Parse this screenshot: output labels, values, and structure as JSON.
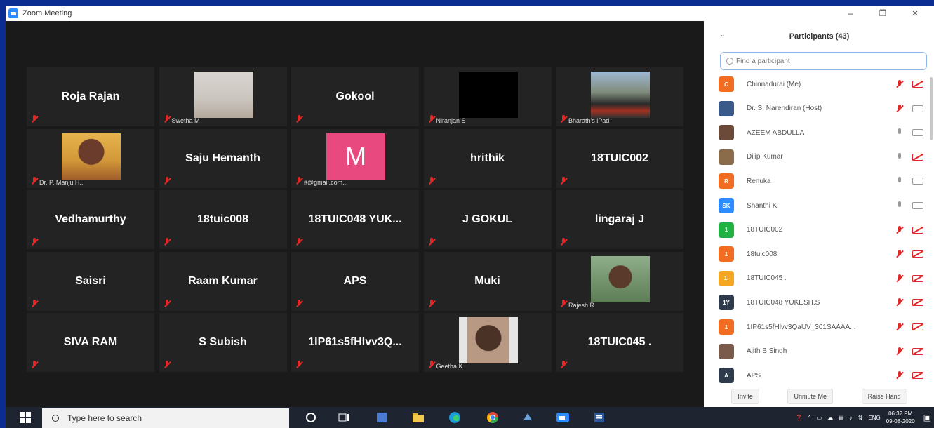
{
  "window": {
    "title": "Zoom Meeting",
    "controls": {
      "minimize": "–",
      "restore": "❐",
      "close": "✕"
    }
  },
  "gallery": {
    "tiles": [
      {
        "name": "Roja Rajan",
        "caption": ""
      },
      {
        "name": "",
        "caption": "Swetha M",
        "photo": "ph-roja-photo"
      },
      {
        "name": "Gokool",
        "caption": ""
      },
      {
        "name": "",
        "caption": "Niranjan S",
        "photo": "ph-black"
      },
      {
        "name": "",
        "caption": "Bharath's iPad",
        "photo": "ph-bike"
      },
      {
        "name": "",
        "caption": "Dr. P. Manju H...",
        "photo": "ph-woman"
      },
      {
        "name": "Saju Hemanth",
        "caption": ""
      },
      {
        "name": "",
        "caption": "#@gmail.com...",
        "photo": "ph-m",
        "letter": "M"
      },
      {
        "name": "hrithik",
        "caption": ""
      },
      {
        "name": "18TUIC002",
        "caption": ""
      },
      {
        "name": "Vedhamurthy",
        "caption": ""
      },
      {
        "name": "18tuic008",
        "caption": ""
      },
      {
        "name": "18TUIC048  YUK...",
        "caption": ""
      },
      {
        "name": "J GOKUL",
        "caption": ""
      },
      {
        "name": "lingaraj J",
        "caption": ""
      },
      {
        "name": "Saisri",
        "caption": ""
      },
      {
        "name": "Raam Kumar",
        "caption": ""
      },
      {
        "name": "APS",
        "caption": ""
      },
      {
        "name": "Muki",
        "caption": ""
      },
      {
        "name": "",
        "caption": "Rajesh R",
        "photo": "ph-rajesh"
      },
      {
        "name": "SIVA RAM",
        "caption": ""
      },
      {
        "name": "S Subish",
        "caption": ""
      },
      {
        "name": "1IP61s5fHlvv3Q...",
        "caption": ""
      },
      {
        "name": "",
        "caption": "Geetha K",
        "photo": "ph-geetha"
      },
      {
        "name": "18TUIC045 .",
        "caption": ""
      }
    ]
  },
  "participants_panel": {
    "title": "Participants (43)",
    "collapse_icon": "⌄",
    "search_placeholder": "Find a participant",
    "participants": [
      {
        "name": "Chinnadurai (Me)",
        "initials": "C",
        "color": "#f26d21",
        "mic": "muted",
        "video": "off"
      },
      {
        "name": "Dr. S. Narendiran (Host)",
        "initials": "",
        "color": "#3a5a8a",
        "mic": "muted",
        "video": "on"
      },
      {
        "name": "AZEEM ABDULLA",
        "initials": "",
        "color": "#6b4a3a",
        "mic": "on",
        "video": "on"
      },
      {
        "name": "Dilip Kumar",
        "initials": "",
        "color": "#8a6b4a",
        "mic": "on",
        "video": "off"
      },
      {
        "name": "Renuka",
        "initials": "R",
        "color": "#f26d21",
        "mic": "on",
        "video": "on"
      },
      {
        "name": "Shanthi K",
        "initials": "SK",
        "color": "#2d8cff",
        "mic": "on",
        "video": "on"
      },
      {
        "name": "18TUIC002",
        "initials": "1",
        "color": "#1fb141",
        "mic": "muted",
        "video": "off"
      },
      {
        "name": "18tuic008",
        "initials": "1",
        "color": "#f26d21",
        "mic": "muted",
        "video": "off"
      },
      {
        "name": "18TUIC045 .",
        "initials": "1.",
        "color": "#f5a623",
        "mic": "muted",
        "video": "off"
      },
      {
        "name": "18TUIC048 YUKESH.S",
        "initials": "1Y",
        "color": "#2f3b4c",
        "mic": "muted",
        "video": "off"
      },
      {
        "name": "1IP61s5fHlvv3QaUV_301SAAAA...",
        "initials": "1",
        "color": "#f26d21",
        "mic": "muted",
        "video": "off"
      },
      {
        "name": "Ajith B Singh",
        "initials": "",
        "color": "#7a5a4a",
        "mic": "muted",
        "video": "off"
      },
      {
        "name": "APS",
        "initials": "A",
        "color": "#2f3b4c",
        "mic": "muted",
        "video": "off"
      }
    ],
    "footer": {
      "invite": "Invite",
      "unmute_me": "Unmute Me",
      "raise_hand": "Raise Hand"
    }
  },
  "taskbar": {
    "search_placeholder": "Type here to search",
    "language": "ENG",
    "time": "06:32 PM",
    "date": "09-08-2020"
  }
}
